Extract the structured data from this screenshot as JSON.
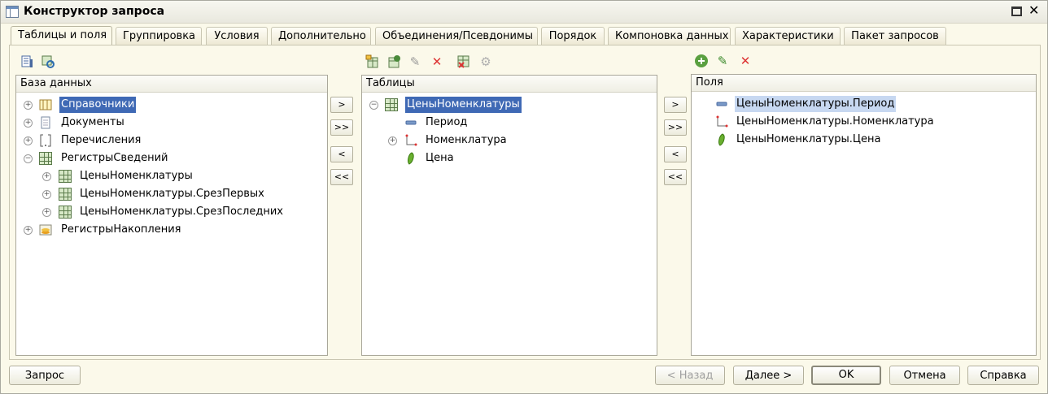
{
  "window": {
    "title": "Конструктор запроса"
  },
  "tabs": [
    {
      "label": "Таблицы и поля"
    },
    {
      "label": "Группировка"
    },
    {
      "label": "Условия"
    },
    {
      "label": "Дополнительно"
    },
    {
      "label": "Объединения/Псевдонимы"
    },
    {
      "label": "Порядок"
    },
    {
      "label": "Компоновка данных"
    },
    {
      "label": "Характеристики"
    },
    {
      "label": "Пакет запросов"
    }
  ],
  "database_panel": {
    "header": "База данных",
    "items": [
      {
        "label": "Справочники",
        "icon": "catalog-icon",
        "expander": "+"
      },
      {
        "label": "Документы",
        "icon": "document-icon",
        "expander": "+"
      },
      {
        "label": "Перечисления",
        "icon": "enum-icon",
        "expander": "+"
      },
      {
        "label": "РегистрыСведений",
        "icon": "register-icon",
        "expander": "−"
      },
      {
        "label": "ЦеныНоменклатуры",
        "icon": "register-icon",
        "expander": "+"
      },
      {
        "label": "ЦеныНоменклатуры.СрезПервых",
        "icon": "register-icon",
        "expander": "+"
      },
      {
        "label": "ЦеныНоменклатуры.СрезПоследних",
        "icon": "register-icon",
        "expander": "+"
      },
      {
        "label": "РегистрыНакопления",
        "icon": "accumulation-register-icon",
        "expander": "+"
      }
    ]
  },
  "tables_panel": {
    "header": "Таблицы",
    "items": [
      {
        "label": "ЦеныНоменклатуры",
        "icon": "register-icon",
        "expander": "−"
      },
      {
        "label": "Период",
        "icon": "dimension-icon"
      },
      {
        "label": "Номенклатура",
        "icon": "reference-icon",
        "expander": "+"
      },
      {
        "label": "Цена",
        "icon": "resource-icon"
      }
    ]
  },
  "fields_panel": {
    "header": "Поля",
    "items": [
      {
        "label": "ЦеныНоменклатуры.Период",
        "icon": "dimension-icon"
      },
      {
        "label": "ЦеныНоменклатуры.Номенклатура",
        "icon": "reference-icon"
      },
      {
        "label": "ЦеныНоменклатуры.Цена",
        "icon": "resource-icon"
      }
    ]
  },
  "move_buttons": {
    "add_one": ">",
    "add_all": ">>",
    "remove_one": "<",
    "remove_all": "<<"
  },
  "footer": {
    "query": "Запрос",
    "back": "< Назад",
    "next": "Далее >",
    "ok": "OK",
    "cancel": "Отмена",
    "help": "Справка"
  },
  "colors": {
    "selection": "#3f69b5",
    "background": "#fbf9ea"
  }
}
